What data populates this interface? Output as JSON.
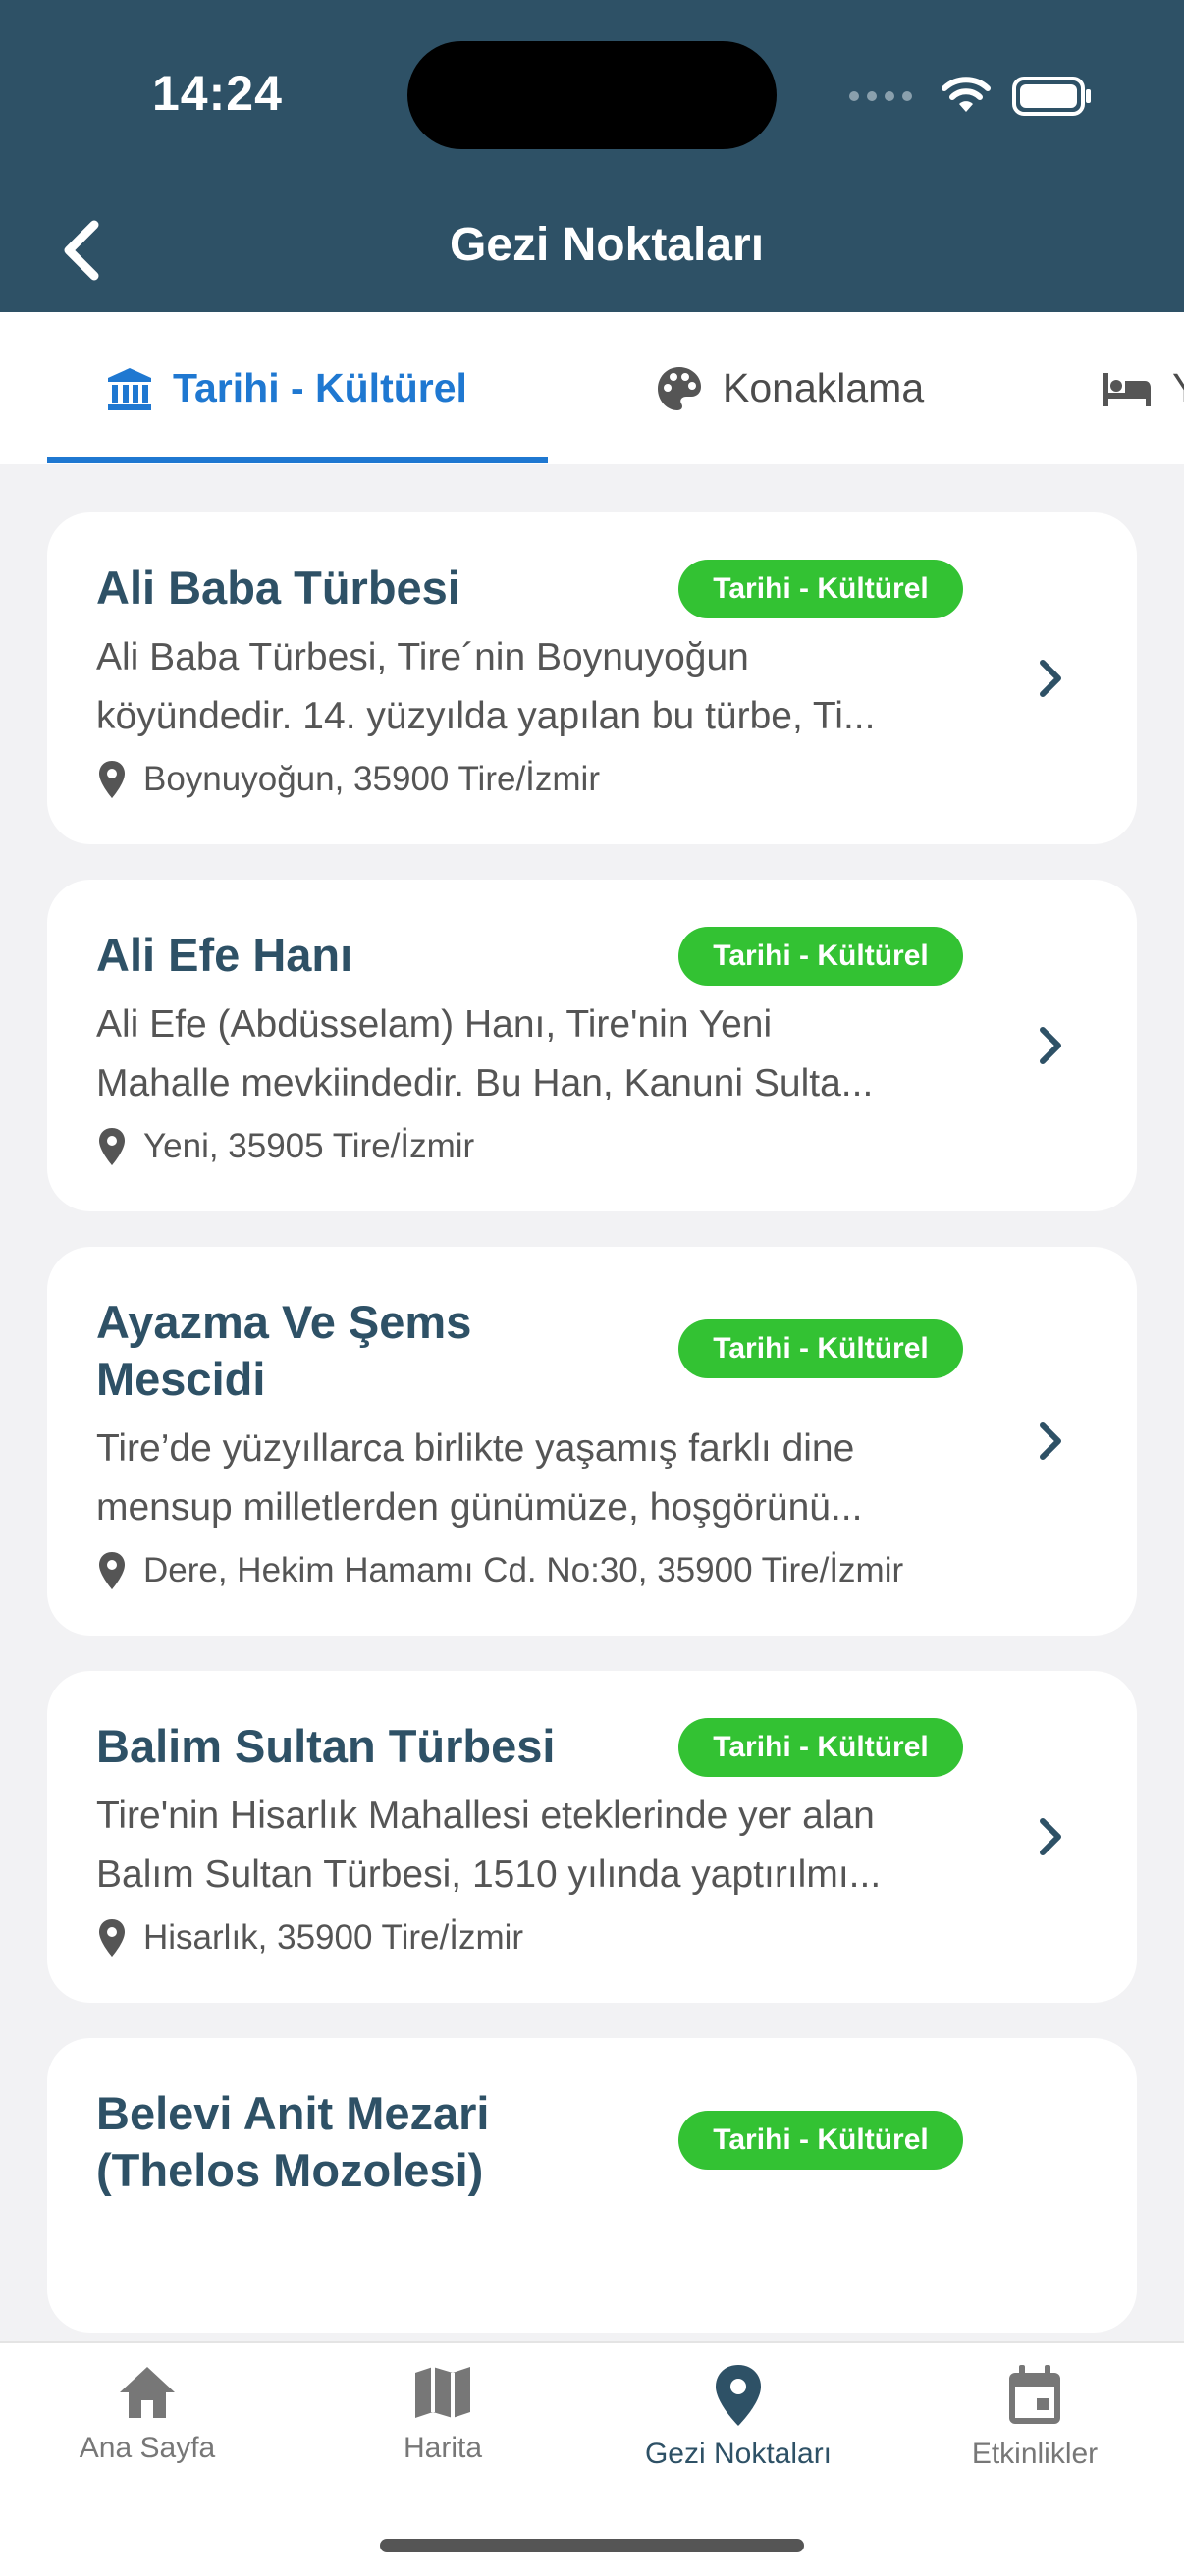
{
  "status_bar": {
    "time": "14:24"
  },
  "header": {
    "title": "Gezi Noktaları",
    "back_icon": "chevron-left-icon"
  },
  "tabs": [
    {
      "label": "Tarihi - Kültürel",
      "icon": "museum-icon",
      "active": true
    },
    {
      "label": "Konaklama",
      "icon": "palette-icon",
      "active": false
    },
    {
      "label": "Y",
      "icon": "bed-icon",
      "active": false
    }
  ],
  "places": [
    {
      "title": "Ali Baba Türbesi",
      "badge": "Tarihi - Kültürel",
      "desc_line1": "Ali Baba Türbesi, Tire´nin Boynuyoğun",
      "desc_line2": "köyündedir. 14. yüzyılda yapılan bu türbe, Ti...",
      "address": "Boynuyoğun, 35900 Tire/İzmir"
    },
    {
      "title": "Ali Efe Hanı",
      "badge": "Tarihi - Kültürel",
      "desc_line1": "Ali Efe (Abdüsselam) Hanı, Tire'nin Yeni",
      "desc_line2": "Mahalle mevkiindedir. Bu Han, Kanuni Sulta...",
      "address": "Yeni, 35905 Tire/İzmir"
    },
    {
      "title": "Ayazma Ve Şems Mescidi",
      "badge": "Tarihi - Kültürel",
      "desc_line1": "Tire’de yüzyıllarca birlikte yaşamış farklı dine",
      "desc_line2": "mensup milletlerden günümüze, hoşgörünü...",
      "address": "Dere, Hekim Hamamı Cd. No:30, 35900 Tire/İzmir"
    },
    {
      "title": "Balim Sultan Türbesi",
      "badge": "Tarihi - Kültürel",
      "desc_line1": "Tire'nin Hisarlık Mahallesi eteklerinde yer alan",
      "desc_line2": "Balım Sultan Türbesi, 1510 yılında yaptırılmı...",
      "address": "Hisarlık, 35900 Tire/İzmir"
    },
    {
      "title": "Belevi Anit Mezari (Thelos Mozolesi)",
      "badge": "Tarihi - Kültürel",
      "desc_line1": "",
      "desc_line2": "",
      "address": ""
    }
  ],
  "bottom_nav": [
    {
      "label": "Ana Sayfa",
      "icon": "home-icon",
      "active": false
    },
    {
      "label": "Harita",
      "icon": "map-icon",
      "active": false
    },
    {
      "label": "Gezi Noktaları",
      "icon": "location-pin-icon",
      "active": true
    },
    {
      "label": "Etkinlikler",
      "icon": "calendar-icon",
      "active": false
    }
  ],
  "colors": {
    "header_bg": "#2e5166",
    "accent_blue": "#1f78d1",
    "badge_green": "#33c233",
    "title_color": "#2e5166"
  }
}
